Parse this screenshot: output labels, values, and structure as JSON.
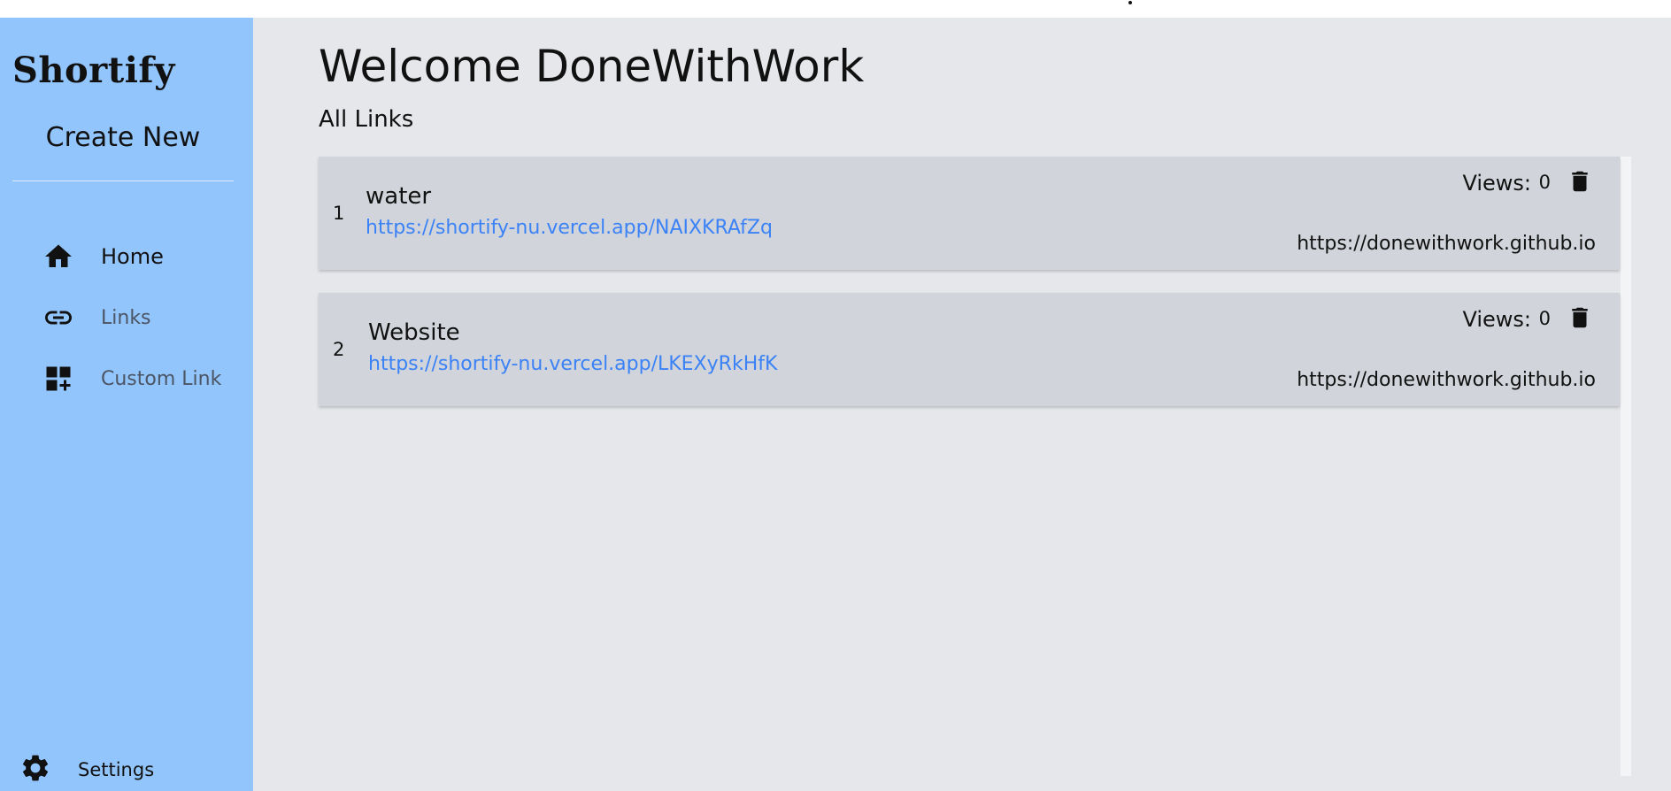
{
  "sidebar": {
    "brand": "Shortify",
    "create_new": "Create New",
    "nav": [
      {
        "label": "Home",
        "icon": "home-icon"
      },
      {
        "label": "Links",
        "icon": "link-icon"
      },
      {
        "label": "Custom Link",
        "icon": "dashboard-add-icon"
      }
    ],
    "settings": {
      "label": "Settings",
      "icon": "gear-icon"
    }
  },
  "main": {
    "welcome": "Welcome DoneWithWork",
    "section_title": "All Links",
    "links": [
      {
        "index": "1",
        "title": "water",
        "short_url": "https://shortify-nu.vercel.app/NAIXKRAfZq",
        "views_label": "Views:",
        "views": "0",
        "original_url": "https://donewithwork.github.io"
      },
      {
        "index": "2",
        "title": "Website",
        "short_url": "https://shortify-nu.vercel.app/LKEXyRkHfK",
        "views_label": "Views:",
        "views": "0",
        "original_url": "https://donewithwork.github.io"
      }
    ]
  },
  "colors": {
    "sidebar_bg": "#93c5fd",
    "main_bg": "#e5e7eb",
    "card_bg": "#d1d5db",
    "link_color": "#3b82f6"
  }
}
